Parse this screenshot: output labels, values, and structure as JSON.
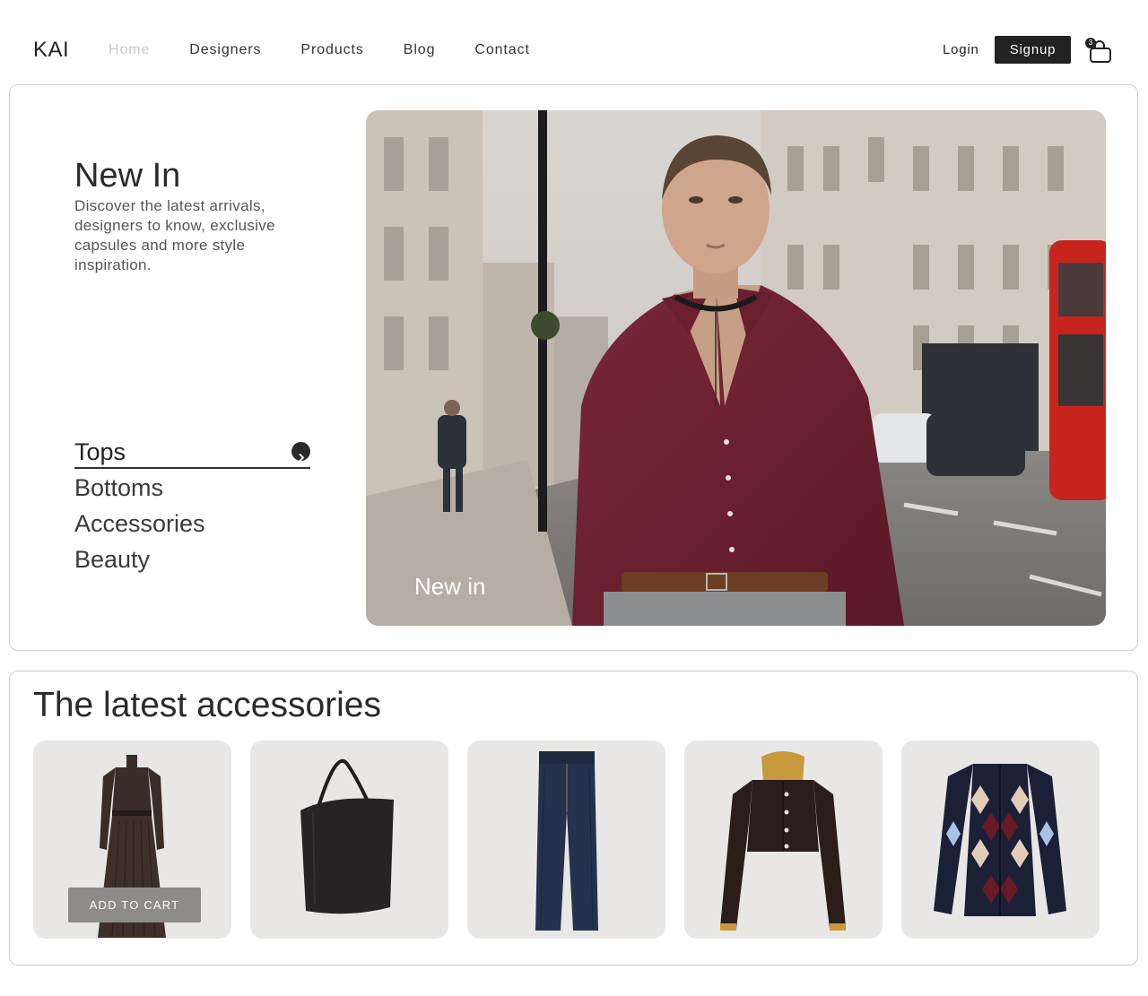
{
  "nav": {
    "logo": "KAI",
    "links": [
      "Home",
      "Designers",
      "Products",
      "Blog",
      "Contact"
    ],
    "active_link": "Home",
    "login_label": "Login",
    "signup_label": "Signup",
    "cart_count": "3",
    "cart_icon": "shopping-bag-icon"
  },
  "hero": {
    "title": "New In",
    "description": "Discover the latest arrivals, designers to know, exclusive capsules and more style inspiration.",
    "categories": [
      "Tops",
      "Bottoms",
      "Accessories",
      "Beauty"
    ],
    "active_category": "Tops",
    "arrow_icon": "chevron-right-icon",
    "image_caption": "New in"
  },
  "accessories": {
    "title": "The latest accessories",
    "add_to_cart_label": "ADD TO CART",
    "products": [
      "dress",
      "tote-bag",
      "jeans",
      "leather-jacket",
      "argyle-cardigan"
    ]
  },
  "colors": {
    "accent": "#222222",
    "card_bg": "#e8e7e6",
    "shirt": "#6e2232",
    "add_button": "#8e8c8b"
  }
}
